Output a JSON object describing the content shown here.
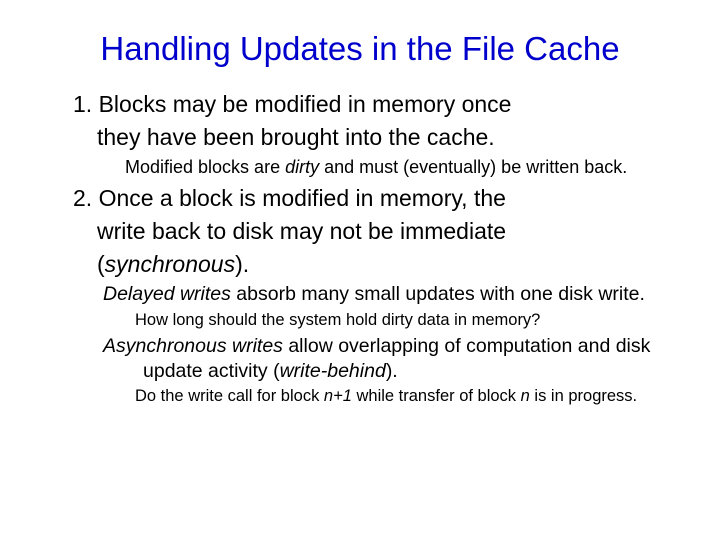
{
  "title": "Handling Updates in the File Cache",
  "p1_a": "1. Blocks may be modified in memory once",
  "p1_b": "they have been brought into the cache.",
  "p1_sub_a": "Modified blocks are ",
  "p1_sub_em": "dirty",
  "p1_sub_b": " and must (eventually) be written back.",
  "p2_a": "2. Once a block is modified in memory, the",
  "p2_b": "write back to disk may not be immediate",
  "p2_c": "(",
  "p2_c_em": "synchronous",
  "p2_c2": ").",
  "dw_em": "Delayed writes",
  "dw_rest": " absorb many small updates with one disk write.",
  "dw_sub": "How long should the system hold dirty data in memory?",
  "aw_em": "Asynchronous writes",
  "aw_rest_a": " allow overlapping of computation and disk update activity (",
  "aw_rest_em": "write-behind",
  "aw_rest_b": ").",
  "aw_sub_a": "Do the write call for block ",
  "aw_sub_n1": "n+1",
  "aw_sub_b": " while transfer of block ",
  "aw_sub_n2": "n",
  "aw_sub_c": " is in progress."
}
